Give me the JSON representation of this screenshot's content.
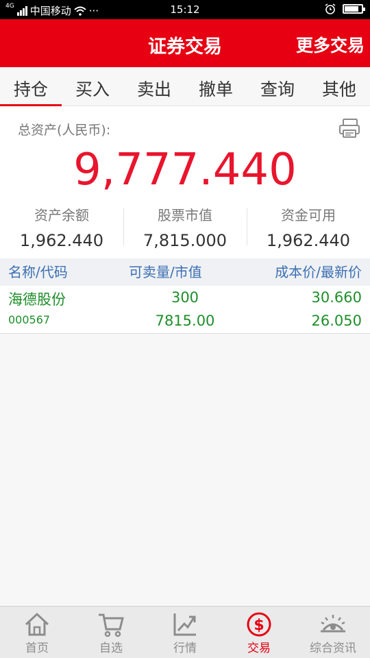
{
  "status_bar": {
    "network": "4G",
    "carrier": "中国移动",
    "dots": "···",
    "time": "15:12",
    "battery_level": 0.85
  },
  "header": {
    "title": "证券交易",
    "more": "更多交易"
  },
  "tabs": [
    {
      "label": "持仓",
      "active": true
    },
    {
      "label": "买入"
    },
    {
      "label": "卖出"
    },
    {
      "label": "撤单"
    },
    {
      "label": "查询"
    },
    {
      "label": "其他"
    }
  ],
  "summary": {
    "label": "总资产(人民币):",
    "total": "9,777.440",
    "stats": [
      {
        "label": "资产余额",
        "value": "1,962.440"
      },
      {
        "label": "股票市值",
        "value": "7,815.000"
      },
      {
        "label": "资金可用",
        "value": "1,962.440"
      }
    ]
  },
  "table": {
    "headers": [
      "名称/代码",
      "可卖量/市值",
      "成本价/最新价"
    ],
    "rows": [
      {
        "name": "海德股份",
        "code": "000567",
        "qty": "300",
        "market_value": "7815.00",
        "cost": "30.660",
        "latest": "26.050"
      }
    ]
  },
  "bottom_nav": [
    {
      "label": "首页",
      "icon": "home-icon"
    },
    {
      "label": "自选",
      "icon": "cart-icon"
    },
    {
      "label": "行情",
      "icon": "chart-icon"
    },
    {
      "label": "交易",
      "icon": "dollar-icon",
      "active": true
    },
    {
      "label": "综合资讯",
      "icon": "eye-icon"
    }
  ],
  "colors": {
    "brand_red": "#e60012",
    "total_red": "#e8152d",
    "stock_green": "#1e8e2a",
    "header_blue": "#3c6fb3"
  }
}
